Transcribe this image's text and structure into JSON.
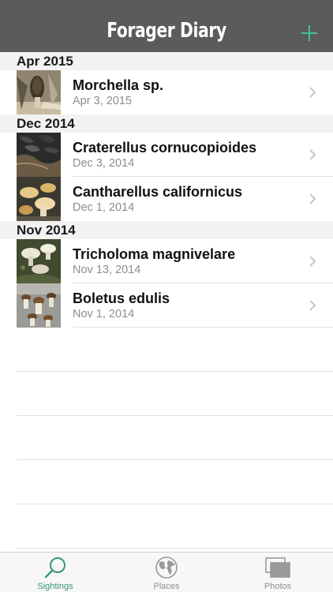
{
  "app": {
    "title": "Forager Diary",
    "accent_color": "#3ec494",
    "navbar_color": "#5b5b5b",
    "add_icon": "plus-icon"
  },
  "sections": [
    {
      "header": "Apr 2015",
      "items": [
        {
          "name": "Morchella sp.",
          "date": "Apr 3, 2015",
          "thumb": "morel-photo"
        }
      ]
    },
    {
      "header": "Dec 2014",
      "items": [
        {
          "name": "Craterellus cornucopioides",
          "date": "Dec 3, 2014",
          "thumb": "black-trumpet-photo"
        },
        {
          "name": "Cantharellus californicus",
          "date": "Dec 1, 2014",
          "thumb": "chanterelle-photo"
        }
      ]
    },
    {
      "header": "Nov 2014",
      "items": [
        {
          "name": "Tricholoma magnivelare",
          "date": "Nov 13, 2014",
          "thumb": "matsutake-photo"
        },
        {
          "name": "Boletus edulis",
          "date": "Nov 1, 2014",
          "thumb": "porcini-photo"
        }
      ]
    }
  ],
  "tabbar": {
    "tabs": [
      {
        "label": "Sightings",
        "icon": "magnifier-icon",
        "active": true
      },
      {
        "label": "Places",
        "icon": "globe-icon",
        "active": false
      },
      {
        "label": "Photos",
        "icon": "photos-icon",
        "active": false
      }
    ],
    "active_color": "#3a9478"
  }
}
